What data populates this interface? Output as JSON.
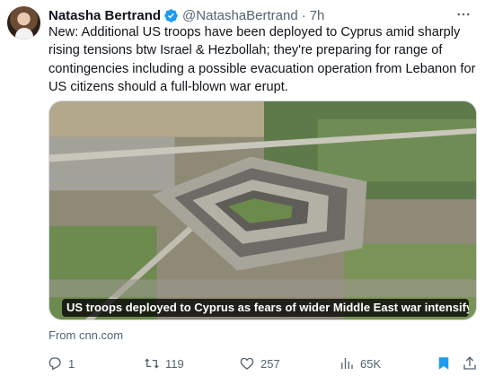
{
  "author": {
    "name": "Natasha Bertrand",
    "handle": "@NatashaBertrand",
    "separator": "·",
    "time": "7h",
    "verified_color": "#1d9bf0"
  },
  "tweet": {
    "text": "New: Additional US troops have been deployed to Cyprus amid sharply rising tensions btw Israel & Hezbollah; they're preparing for range of contingencies including a possible evacuation operation from Lebanon for US citizens should a full-blown war erupt."
  },
  "media": {
    "caption": "US troops deployed to Cyprus as fears of wider Middle East war intensify | CN...",
    "source": "From cnn.com"
  },
  "actions": {
    "reply_count": "1",
    "retweet_count": "119",
    "like_count": "257",
    "view_count": "65K"
  },
  "icons": {
    "more": "more-icon",
    "verified": "verified-badge-icon",
    "reply": "reply-icon",
    "retweet": "retweet-icon",
    "like": "heart-icon",
    "views": "views-icon",
    "bookmark": "bookmark-icon",
    "share": "share-icon"
  },
  "colors": {
    "text": "#0f1419",
    "secondary": "#536471",
    "accent": "#1d9bf0",
    "border": "#cfd9de"
  }
}
